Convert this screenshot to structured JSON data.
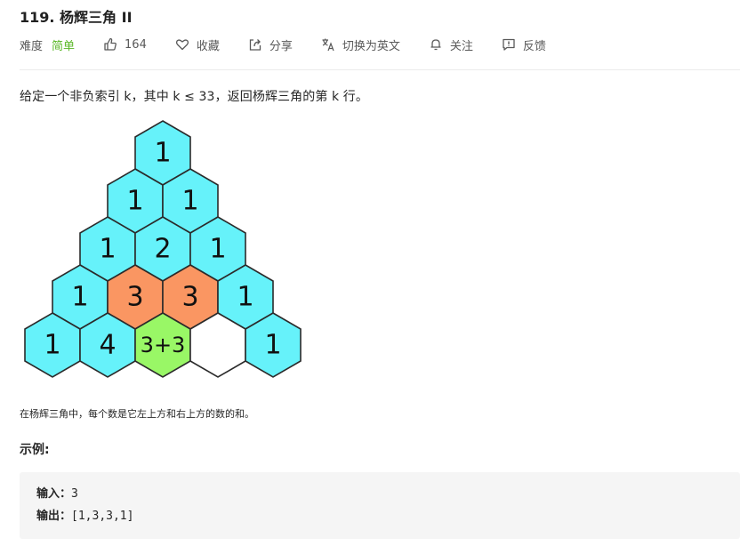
{
  "problem": {
    "title": "119. 杨辉三角 II",
    "difficulty_label": "难度",
    "difficulty_value": "简单",
    "likes": "164",
    "favorite_label": "收藏",
    "share_label": "分享",
    "switch_lang_label": "切换为英文",
    "follow_label": "关注",
    "feedback_label": "反馈"
  },
  "description": "给定一个非负索引 k，其中 k ≤ 33，返回杨辉三角的第 k 行。",
  "figure": {
    "rows": [
      [
        "1"
      ],
      [
        "1",
        "1"
      ],
      [
        "1",
        "2",
        "1"
      ],
      [
        "1",
        "3",
        "3",
        "1"
      ],
      [
        "1",
        "4",
        "3+3",
        "",
        "1"
      ]
    ],
    "caption": "在杨辉三角中，每个数是它左上方和右上方的数的和。"
  },
  "example": {
    "title": "示例:",
    "input_label": "输入：",
    "input_value": "3",
    "output_label": "输出：",
    "output_value": "[1,3,3,1]"
  },
  "colors": {
    "cyan": "#66f2fa",
    "orange": "#fa9662",
    "green": "#99f766",
    "white": "#ffffff",
    "accent_easy": "#5ab726"
  },
  "icons": [
    "thumbs-up-icon",
    "heart-icon",
    "share-icon",
    "translate-icon",
    "bell-icon",
    "feedback-icon"
  ]
}
